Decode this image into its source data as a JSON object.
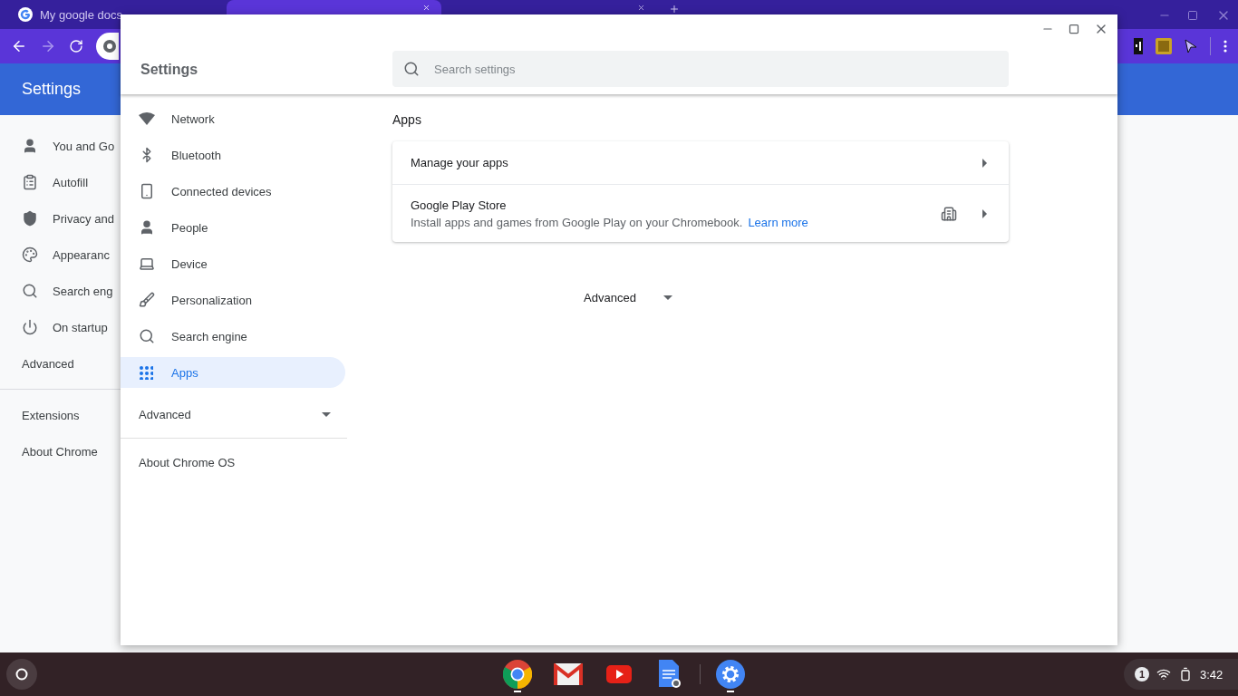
{
  "browser": {
    "tabs": [
      {
        "title": "My google docs",
        "selected": false
      },
      {
        "selected": true
      },
      {
        "selected": false
      }
    ],
    "header_title": "Settings",
    "sidebar": {
      "items": [
        "You and Go",
        "Autofill",
        "Privacy and",
        "Appearanc",
        "Search eng",
        "On startup"
      ],
      "advanced": "Advanced",
      "links": [
        "Extensions",
        "About Chrome"
      ]
    }
  },
  "window": {
    "title": "Settings",
    "search": {
      "placeholder": "Search settings"
    },
    "nav": [
      {
        "label": "Network",
        "selected": false
      },
      {
        "label": "Bluetooth",
        "selected": false
      },
      {
        "label": "Connected devices",
        "selected": false
      },
      {
        "label": "People",
        "selected": false
      },
      {
        "label": "Device",
        "selected": false
      },
      {
        "label": "Personalization",
        "selected": false
      },
      {
        "label": "Search engine",
        "selected": false
      },
      {
        "label": "Apps",
        "selected": true
      }
    ],
    "advanced": {
      "label": "Advanced",
      "expanded": false
    },
    "about": "About Chrome OS",
    "section_title": "Apps",
    "rows": [
      {
        "title": "Manage your apps"
      },
      {
        "title": "Google Play Store",
        "description": "Install apps and games from Google Play on your Chromebook.",
        "link": "Learn more"
      }
    ],
    "advanced_toggle": {
      "label": "Advanced",
      "expanded": false
    }
  },
  "shelf": {
    "apps": [
      {
        "kind": "chrome",
        "running": true
      },
      {
        "kind": "gmail",
        "running": false
      },
      {
        "kind": "youtube",
        "running": false
      },
      {
        "kind": "docs",
        "running": false
      },
      {
        "kind": "settings",
        "running": true
      }
    ],
    "notifications": "1",
    "time": "3:42"
  }
}
